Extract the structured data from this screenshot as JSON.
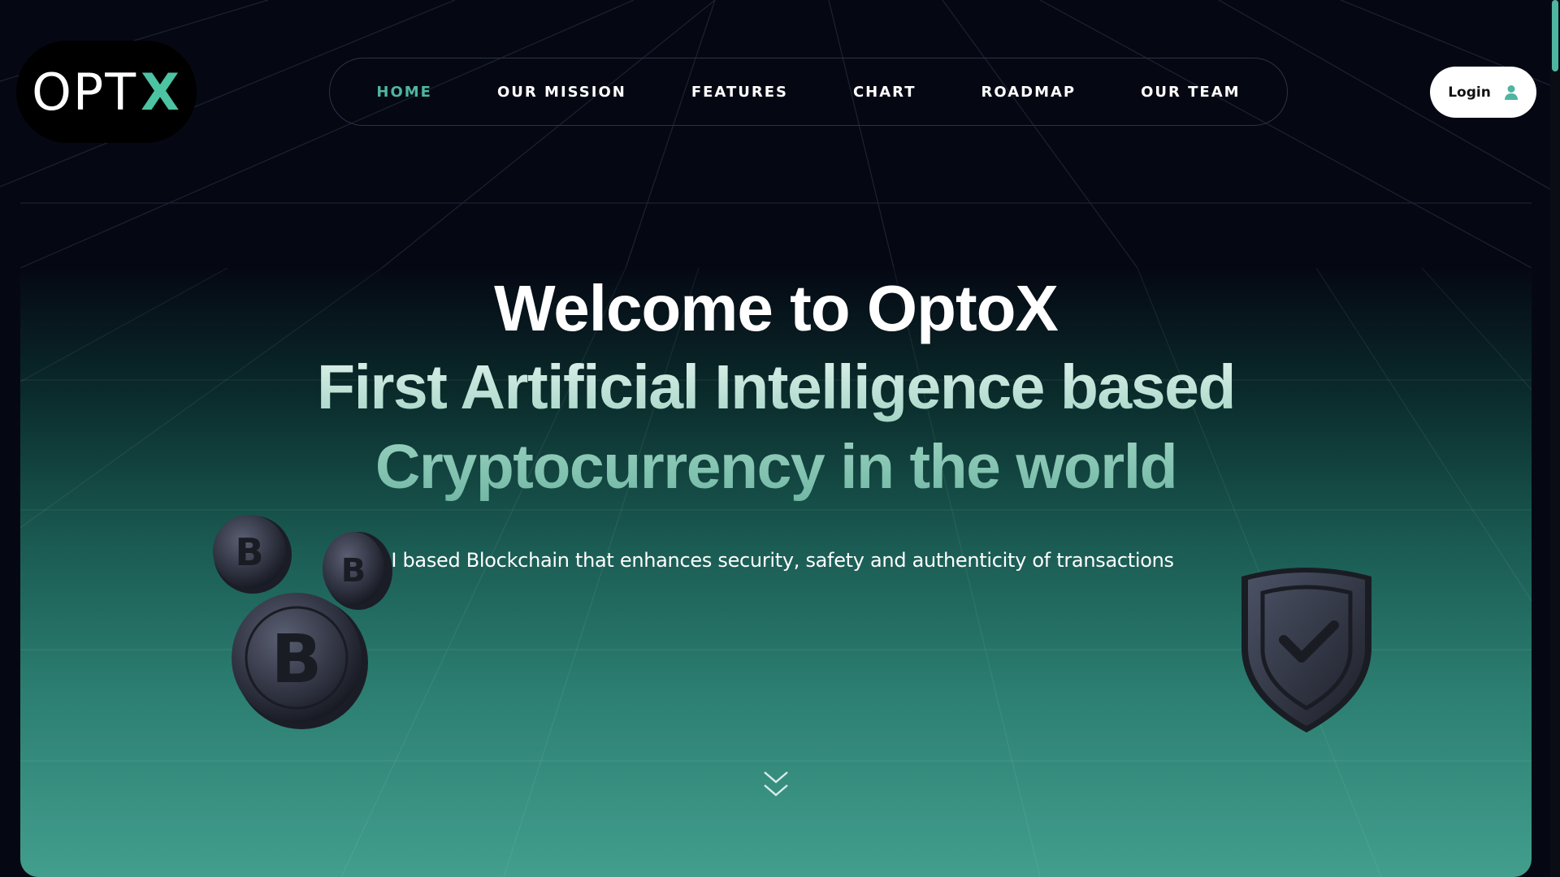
{
  "brand": {
    "logo_text": "OPT",
    "logo_x": "X",
    "accent_color": "#4fb5a0"
  },
  "nav": {
    "items": [
      {
        "label": "HOME",
        "active": true
      },
      {
        "label": "OUR MISSION",
        "active": false
      },
      {
        "label": "FEATURES",
        "active": false
      },
      {
        "label": "CHART",
        "active": false
      },
      {
        "label": "ROADMAP",
        "active": false
      },
      {
        "label": "OUR TEAM",
        "active": false
      }
    ]
  },
  "header": {
    "login_label": "Login",
    "login_icon": "user-icon"
  },
  "hero": {
    "title": "Welcome to OptoX",
    "subtitle_line1": "First Artificial Intelligence based",
    "subtitle_line2": "Cryptocurrency in the world",
    "tagline": "AI based Blockchain that enhances security, safety and authenticity of transactions",
    "left_graphic": "bitcoin-coins-icon",
    "right_graphic": "shield-check-icon",
    "scroll_icon": "chevron-double-down-icon"
  }
}
